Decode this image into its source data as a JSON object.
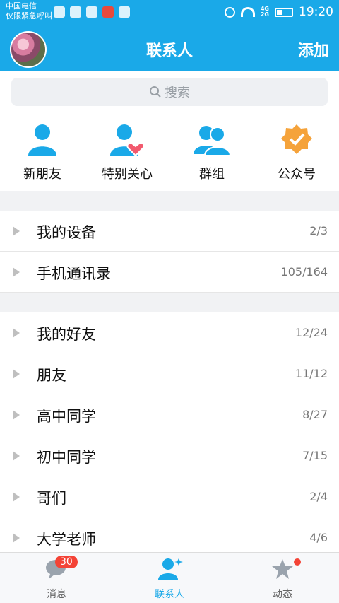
{
  "status_bar": {
    "carrier_line1": "中国电信",
    "carrier_line2": "仅限紧急呼叫",
    "time": "19:20",
    "network_label_1": "4G",
    "network_label_2": "2G"
  },
  "header": {
    "title": "联系人",
    "add_label": "添加"
  },
  "search": {
    "placeholder": "搜索"
  },
  "quick_actions": [
    {
      "label": "新朋友",
      "icon": "person-icon"
    },
    {
      "label": "特别关心",
      "icon": "person-heart-icon"
    },
    {
      "label": "群组",
      "icon": "group-icon"
    },
    {
      "label": "公众号",
      "icon": "badge-check-icon"
    }
  ],
  "sections": [
    {
      "label": "我的设备",
      "count": "2/3"
    },
    {
      "label": "手机通讯录",
      "count": "105/164"
    },
    {
      "label": "我的好友",
      "count": "12/24"
    },
    {
      "label": "朋友",
      "count": "11/12"
    },
    {
      "label": "高中同学",
      "count": "8/27"
    },
    {
      "label": "初中同学",
      "count": "7/15"
    },
    {
      "label": "哥们",
      "count": "2/4"
    },
    {
      "label": "大学老师",
      "count": "4/6"
    }
  ],
  "tabs": [
    {
      "label": "消息",
      "badge": "30"
    },
    {
      "label": "联系人"
    },
    {
      "label": "动态"
    }
  ],
  "colors": {
    "accent": "#1aa9e8",
    "badge": "#f44336",
    "official": "#f5a33b"
  }
}
